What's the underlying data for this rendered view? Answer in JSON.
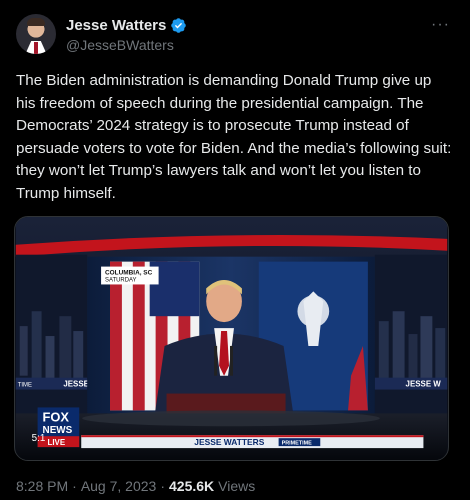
{
  "author": {
    "display_name": "Jesse Watters",
    "handle": "@JesseBWatters",
    "verified": true,
    "verified_color": "#1d9bf0"
  },
  "more_icon": "more-horizontal-icon",
  "tweet": {
    "text": "The Biden administration is demanding Donald Trump give up his freedom of speech during the presidential campaign. The Democrats’ 2024 strategy is to prosecute Trump instead of persuade voters to vote for Biden. And the media’s following suit: they won’t let Trump’s lawyers talk and won’t let you listen to Trump himself."
  },
  "media": {
    "location_tag_line1": "COLUMBIA, SC",
    "location_tag_line2": "SATURDAY",
    "side_banner_left": "JESSE",
    "side_banner_left_tag": "TIME",
    "side_banner_right": "JESSE W",
    "network_logo_line1": "FOX",
    "network_logo_line2": "NEWS",
    "network_logo_line3": "LIVE",
    "lower_third_show": "JESSE WATTERS",
    "lower_third_suffix": "PRIMETIME",
    "time_fragment": "5:1"
  },
  "meta": {
    "time": "8:28 PM",
    "separator1": "·",
    "date": "Aug 7, 2023",
    "separator2": "·",
    "views_count": "425.6K",
    "views_label": "Views"
  },
  "colors": {
    "background": "#000000",
    "text_primary": "#e7e9ea",
    "text_secondary": "#71767b",
    "accent_red": "#d31b22",
    "fox_blue": "#0a2a6b"
  }
}
